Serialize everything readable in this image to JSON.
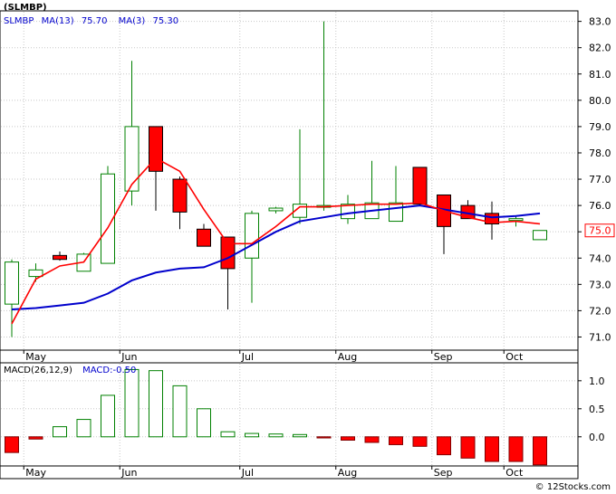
{
  "title": "(SLMBP)",
  "credit": "© 12Stocks.com",
  "colors": {
    "background": "#ffffff",
    "bull_fill": "#ffffff",
    "bull_edge": "#008000",
    "bear_fill": "#ff0000",
    "bear_edge": "#000000",
    "ma13": "#0000cc",
    "ma3": "#ff0000",
    "macd_pos_edge": "#008000",
    "macd_neg_fill": "#ff0000",
    "axis": "#000000",
    "grid": "#c8c8c8",
    "label_blue": "#0000cc"
  },
  "legend": {
    "symbol": "SLMBP",
    "ma13_label": "MA(13)",
    "ma13_value": "75.70",
    "ma3_label": "MA(3)",
    "ma3_value": "75.30"
  },
  "last_price_tag": "75.0",
  "macd_legend": {
    "label": "MACD(26,12,9)",
    "value_label": "MACD:-0.50"
  },
  "chart_data": [
    {
      "type": "candlestick",
      "title": "(SLMBP)",
      "x_tick_labels": [
        "May",
        "Jun",
        "Jul",
        "Aug",
        "Sep",
        "Oct"
      ],
      "x_tick_positions": [
        1,
        5,
        10,
        14,
        18,
        21
      ],
      "y_tick_labels": [
        "71.0",
        "72.0",
        "73.0",
        "74.0",
        "75.0",
        "76.0",
        "77.0",
        "78.0",
        "79.0",
        "80.0",
        "81.0",
        "82.0",
        "83.0"
      ],
      "ylim": [
        70.5,
        83.4
      ],
      "grid": true,
      "candles": [
        {
          "i": 0,
          "open": 72.25,
          "high": 73.95,
          "low": 71.0,
          "close": 73.85
        },
        {
          "i": 1,
          "open": 73.3,
          "high": 73.8,
          "low": 73.1,
          "close": 73.55
        },
        {
          "i": 2,
          "open": 74.1,
          "high": 74.25,
          "low": 73.9,
          "close": 73.95
        },
        {
          "i": 3,
          "open": 73.5,
          "high": 74.2,
          "low": 73.5,
          "close": 74.15
        },
        {
          "i": 4,
          "open": 73.8,
          "high": 77.5,
          "low": 73.8,
          "close": 77.2
        },
        {
          "i": 5,
          "open": 76.55,
          "high": 81.5,
          "low": 76.0,
          "close": 79.0
        },
        {
          "i": 6,
          "open": 79.0,
          "high": 79.0,
          "low": 75.8,
          "close": 77.3
        },
        {
          "i": 7,
          "open": 77.0,
          "high": 77.1,
          "low": 75.1,
          "close": 75.75
        },
        {
          "i": 8,
          "open": 75.1,
          "high": 75.3,
          "low": 74.5,
          "close": 74.45
        },
        {
          "i": 9,
          "open": 74.8,
          "high": 74.8,
          "low": 72.05,
          "close": 73.6
        },
        {
          "i": 10,
          "open": 74.0,
          "high": 75.8,
          "low": 72.3,
          "close": 75.7
        },
        {
          "i": 11,
          "open": 75.8,
          "high": 75.95,
          "low": 75.7,
          "close": 75.9
        },
        {
          "i": 12,
          "open": 75.55,
          "high": 78.9,
          "low": 75.3,
          "close": 76.05
        },
        {
          "i": 13,
          "open": 76.0,
          "high": 83.0,
          "low": 75.8,
          "close": 76.0
        },
        {
          "i": 14,
          "open": 75.5,
          "high": 76.4,
          "low": 75.3,
          "close": 76.05
        },
        {
          "i": 15,
          "open": 75.5,
          "high": 77.7,
          "low": 75.5,
          "close": 76.1
        },
        {
          "i": 16,
          "open": 75.4,
          "high": 77.5,
          "low": 75.4,
          "close": 76.1
        },
        {
          "i": 17,
          "open": 77.45,
          "high": 77.45,
          "low": 76.0,
          "close": 76.05
        },
        {
          "i": 18,
          "open": 76.4,
          "high": 76.4,
          "low": 74.15,
          "close": 75.2
        },
        {
          "i": 19,
          "open": 76.0,
          "high": 76.2,
          "low": 75.5,
          "close": 75.5
        },
        {
          "i": 20,
          "open": 75.7,
          "high": 76.15,
          "low": 74.7,
          "close": 75.3
        },
        {
          "i": 21,
          "open": 75.5,
          "high": 75.6,
          "low": 75.2,
          "close": 75.5
        },
        {
          "i": 22,
          "open": 74.7,
          "high": 75.05,
          "low": 74.7,
          "close": 75.05
        }
      ],
      "series": [
        {
          "name": "MA(13)",
          "x": [
            0,
            1,
            2,
            3,
            4,
            5,
            6,
            7,
            8,
            9,
            10,
            11,
            12,
            13,
            14,
            15,
            16,
            17,
            18,
            19,
            20,
            21,
            22
          ],
          "values": [
            72.05,
            72.1,
            72.2,
            72.3,
            72.65,
            73.15,
            73.45,
            73.6,
            73.65,
            74.0,
            74.5,
            75.0,
            75.4,
            75.55,
            75.7,
            75.8,
            75.9,
            76.0,
            75.85,
            75.7,
            75.55,
            75.6,
            75.7
          ]
        },
        {
          "name": "MA(3)",
          "x": [
            0,
            1,
            2,
            3,
            4,
            5,
            6,
            7,
            8,
            9,
            10,
            11,
            12,
            13,
            14,
            15,
            16,
            17,
            18,
            19,
            20,
            21,
            22
          ],
          "values": [
            71.5,
            73.2,
            73.7,
            73.85,
            75.15,
            76.8,
            77.8,
            77.3,
            75.85,
            74.55,
            74.55,
            75.2,
            75.95,
            75.95,
            76.0,
            76.05,
            76.05,
            76.1,
            75.8,
            75.55,
            75.35,
            75.4,
            75.3
          ]
        }
      ]
    },
    {
      "type": "bar",
      "title": "MACD(26,12,9)",
      "x_tick_labels": [
        "May",
        "Jun",
        "Jul",
        "Aug",
        "Sep",
        "Oct"
      ],
      "x_tick_positions": [
        1,
        5,
        10,
        14,
        18,
        21
      ],
      "y_tick_labels": [
        "0.0",
        "0.5",
        "1.0"
      ],
      "ylim": [
        -0.52,
        1.32
      ],
      "grid": true,
      "series": [
        {
          "name": "MACD",
          "x": [
            0,
            1,
            2,
            3,
            4,
            5,
            6,
            7,
            8,
            9,
            10,
            11,
            12,
            13,
            14,
            15,
            16,
            17,
            18,
            19,
            20,
            21,
            22
          ],
          "values": [
            -0.28,
            -0.04,
            0.18,
            0.31,
            0.74,
            1.2,
            1.18,
            0.91,
            0.5,
            0.09,
            0.06,
            0.05,
            0.04,
            -0.02,
            -0.06,
            -0.1,
            -0.14,
            -0.17,
            -0.32,
            -0.38,
            -0.44,
            -0.44,
            -0.5
          ]
        }
      ]
    }
  ]
}
